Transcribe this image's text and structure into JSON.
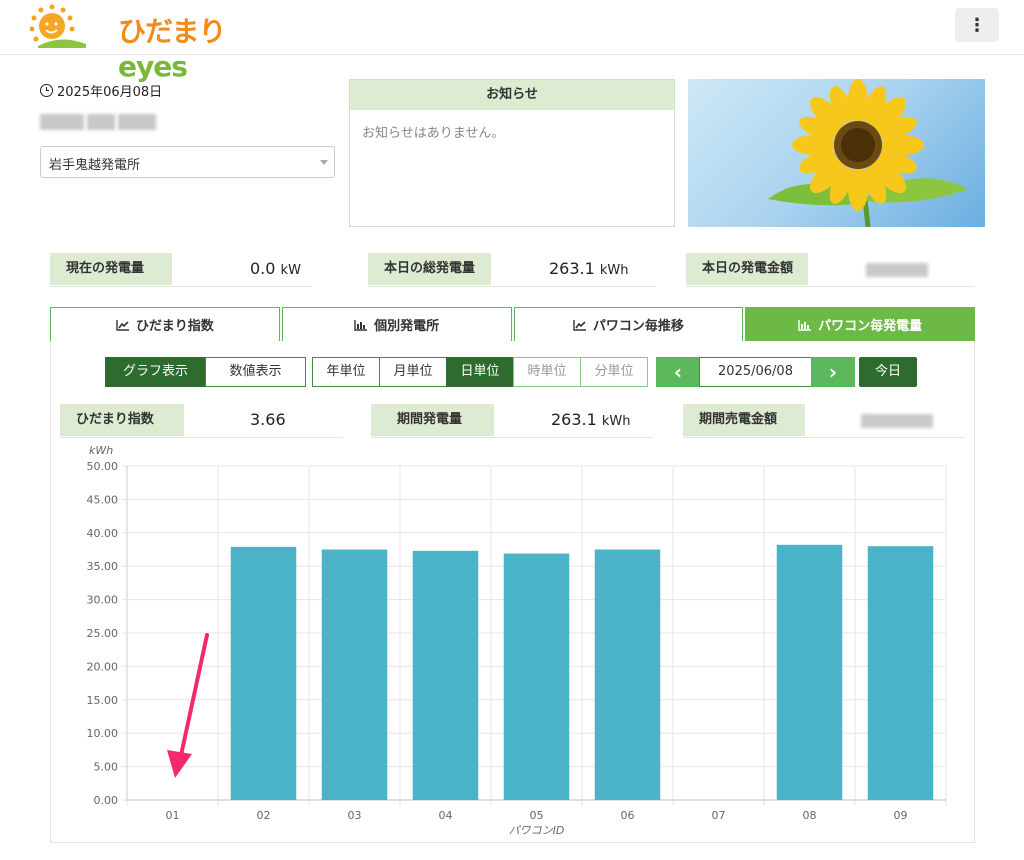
{
  "header": {
    "logo_text_jp": "ひだまり",
    "logo_text_en": "eyes",
    "menu_icon": "kebab-vertical-icon"
  },
  "info": {
    "date": "2025年06月08日",
    "site_select_value": "岩手鬼越発電所"
  },
  "notice": {
    "title": "お知らせ",
    "body": "お知らせはありません。"
  },
  "stats_top": {
    "current_power_label": "現在の発電量",
    "current_power_value": "0.0",
    "current_power_unit": "kW",
    "today_total_label": "本日の総発電量",
    "today_total_value": "263.1",
    "today_total_unit": "kWh",
    "today_amount_label": "本日の発電金額"
  },
  "tabs": [
    {
      "label": "ひだまり指数",
      "icon": "line-chart-icon",
      "active": false
    },
    {
      "label": "個別発電所",
      "icon": "bar-chart-icon",
      "active": false
    },
    {
      "label": "パワコン毎推移",
      "icon": "line-chart-icon",
      "active": false
    },
    {
      "label": "パワコン毎発電量",
      "icon": "bar-chart-icon",
      "active": true
    }
  ],
  "toolbar": {
    "graph_view": "グラフ表示",
    "numeric_view": "数値表示",
    "year_unit": "年単位",
    "month_unit": "月単位",
    "day_unit": "日単位",
    "hour_unit": "時単位",
    "minute_unit": "分単位",
    "prev": "‹",
    "date": "2025/06/08",
    "next": "›",
    "today": "今日"
  },
  "stats_sub": {
    "hidamari_index_label": "ひだまり指数",
    "hidamari_index_value": "3.66",
    "period_power_label": "期間発電量",
    "period_power_value": "263.1",
    "period_power_unit": "kWh",
    "period_sales_label": "期間売電金額"
  },
  "colors": {
    "brand_green": "#6cb947",
    "dark_green": "#2e6b2e",
    "label_bg": "#dcebd2",
    "bar": "#4bb3c7",
    "arrow": "#f5286e"
  },
  "chart_data": {
    "type": "bar",
    "ylabel": "kWh",
    "xlabel": "パワコンID",
    "categories": [
      "01",
      "02",
      "03",
      "04",
      "05",
      "06",
      "07",
      "08",
      "09"
    ],
    "values": [
      0,
      37.9,
      37.5,
      37.3,
      36.9,
      37.5,
      0,
      38.2,
      38.0
    ],
    "ylim": [
      0,
      50
    ],
    "yticks": [
      "0.00",
      "5.00",
      "10.00",
      "15.00",
      "20.00",
      "25.00",
      "30.00",
      "35.00",
      "40.00",
      "45.00",
      "50.00"
    ],
    "grid": true
  }
}
